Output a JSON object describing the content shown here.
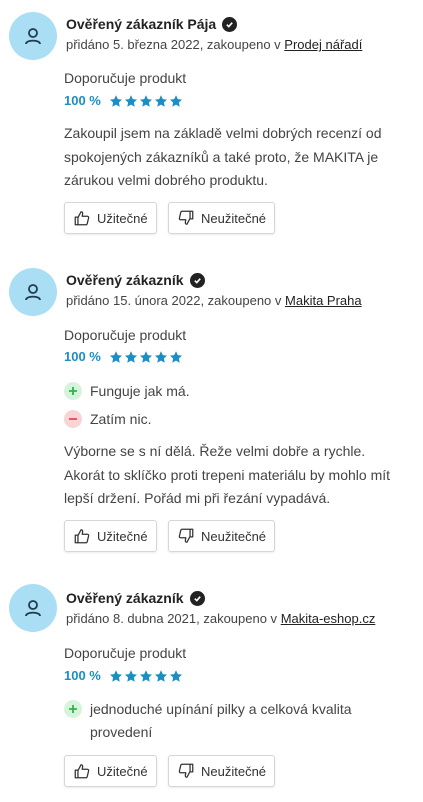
{
  "reviews": [
    {
      "author": "Ověřený zákazník Pája",
      "meta_prefix": "přidáno 5. března 2022, zakoupeno v",
      "shop": "Prodej nářadí",
      "recommend": "Doporučuje produkt",
      "percent": "100 %",
      "stars": 5,
      "pros": [],
      "cons": [],
      "text": "Zakoupil jsem na základě velmi dobrých recenzí od spokojených zákazníků a také proto, že MAKITA je zárukou velmi dobrého produktu.",
      "helpful": "Užitečné",
      "unhelpful": "Neužitečné"
    },
    {
      "author": "Ověřený zákazník",
      "meta_prefix": "přidáno 15. února 2022, zakoupeno v",
      "shop": "Makita Praha",
      "recommend": "Doporučuje produkt",
      "percent": "100 %",
      "stars": 5,
      "pros": [
        "Funguje jak má."
      ],
      "cons": [
        "Zatím nic."
      ],
      "text": "Výborne se s ní dělá. Řeže velmi dobře a rychle. Akorát to sklíčko proti trepeni materiálu by mohlo mít lepší držení. Pořád mi při řezání vypadává.",
      "helpful": "Užitečné",
      "unhelpful": "Neužitečné"
    },
    {
      "author": "Ověřený zákazník",
      "meta_prefix": "přidáno 8. dubna 2021, zakoupeno v",
      "shop": "Makita-eshop.cz",
      "recommend": "Doporučuje produkt",
      "percent": "100 %",
      "stars": 5,
      "pros": [
        "jednoduché upínání pilky a celková kvalita provedení"
      ],
      "cons": [],
      "text": "",
      "helpful": "Užitečné",
      "unhelpful": "Neužitečné"
    }
  ],
  "colors": {
    "accent": "#1b8fc4",
    "avatar": "#a9def4",
    "plus": "#2fb34a",
    "minus": "#e0485a"
  }
}
